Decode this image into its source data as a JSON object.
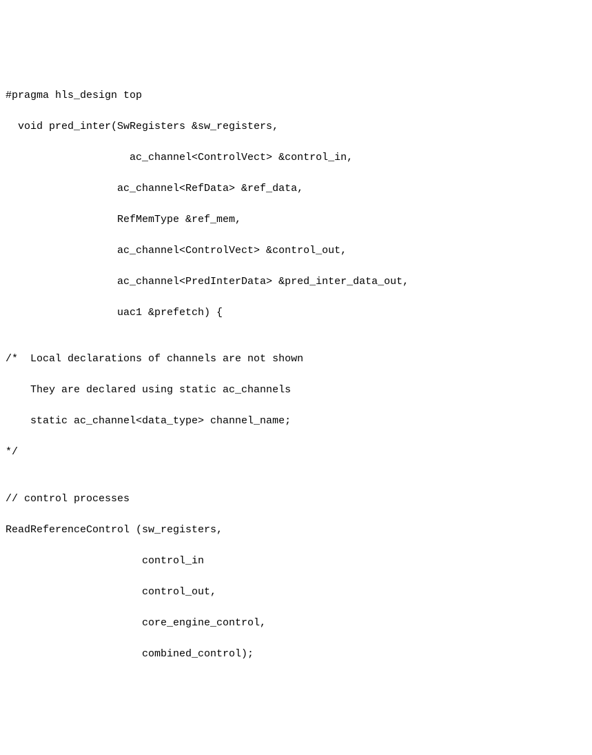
{
  "code": {
    "l1": "#pragma hls_design top",
    "l2": "  void pred_inter(SwRegisters &sw_registers,",
    "l3": "                    ac_channel<ControlVect> &control_in,",
    "l4": "                  ac_channel<RefData> &ref_data,",
    "l5": "                  RefMemType &ref_mem,",
    "l6": "                  ac_channel<ControlVect> &control_out,",
    "l7": "                  ac_channel<PredInterData> &pred_inter_data_out,",
    "l8": "                  uac1 &prefetch) {",
    "l9": "",
    "l10": "/*  Local declarations of channels are not shown",
    "l11": "    They are declared using static ac_channels",
    "l12": "    static ac_channel<data_type> channel_name;",
    "l13": "*/",
    "l14": "",
    "l15": "// control processes",
    "l16": "ReadReferenceControl (sw_registers,",
    "l17": "                      control_in",
    "l18": "                      control_out,",
    "l19": "                      core_engine_control,",
    "l20": "                      combined_control);"
  }
}
